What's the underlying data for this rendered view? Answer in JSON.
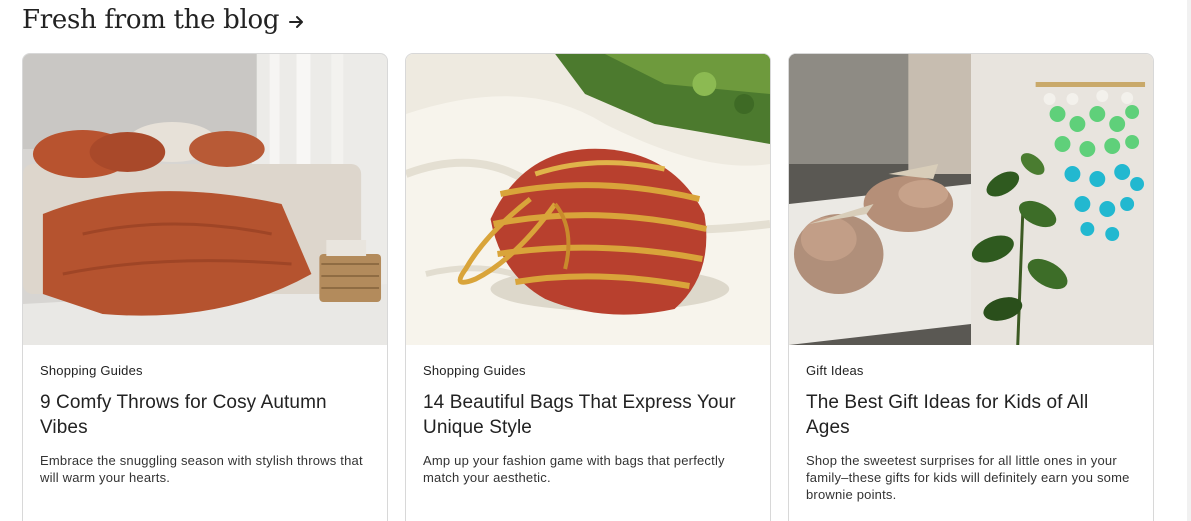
{
  "header": {
    "title": "Fresh from the blog",
    "arrow_icon": "arrow-right-icon"
  },
  "cards": [
    {
      "category": "Shopping Guides",
      "title": "9 Comfy Throws for Cosy Autumn Vibes",
      "description": "Embrace the snuggling season with stylish throws that will warm your hearts.",
      "image_subject": "bedroom with rust throw blanket"
    },
    {
      "category": "Shopping Guides",
      "title": "14 Beautiful Bags That Express Your Unique Style",
      "description": "Amp up your fashion game with bags that perfectly match your aesthetic.",
      "image_subject": "striped knitted bag on white cloth"
    },
    {
      "category": "Gift Ideas",
      "title": "The Best Gift Ideas for Kids of All Ages",
      "description": "Shop the sweetest surprises for all little ones in your family–these gifts for kids will definitely earn you some brownie points.",
      "image_subject": "knitted baby booties and capiz wind chime"
    }
  ],
  "colors": {
    "text": "#222222",
    "border": "#d8d8d8",
    "throw_rust": "#b5532f",
    "bag_red": "#b8402e",
    "bag_yellow": "#d9a43a",
    "chime_teal": "#22b8d0",
    "chime_green": "#5fd07a"
  }
}
